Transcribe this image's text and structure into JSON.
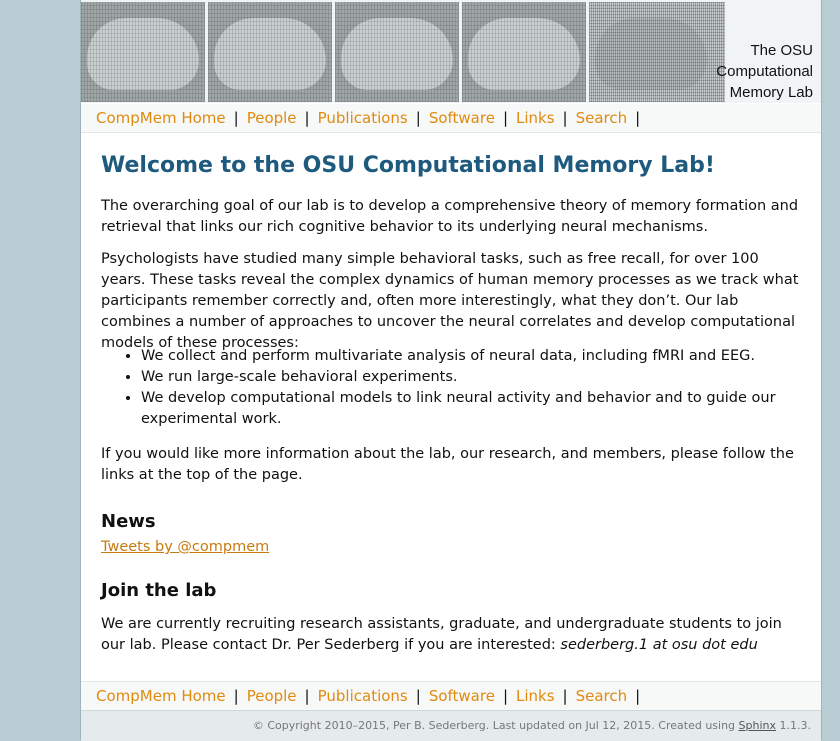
{
  "banner": {
    "title_lines": [
      "The OSU",
      "Computational",
      "Memory Lab"
    ]
  },
  "nav": {
    "items": [
      "CompMem Home",
      "People",
      "Publications",
      "Software",
      "Links",
      "Search"
    ]
  },
  "main": {
    "heading": "Welcome to the OSU Computational Memory Lab!",
    "intro": "The overarching goal of our lab is to develop a comprehensive theory of memory formation and retrieval that links our rich cognitive behavior to its underlying neural mechanisms.",
    "paragraph2": "Psychologists have studied many simple behavioral tasks, such as free recall, for over 100 years. These tasks reveal the complex dynamics of human memory processes as we track what participants remember correctly and, often more interestingly, what they don’t. Our lab combines a number of approaches to uncover the neural correlates and develop computational models of these processes:",
    "bullets": [
      "We collect and perform multivariate analysis of neural data, including fMRI and EEG.",
      "We run large-scale behavioral experiments.",
      "We develop computational models to link neural activity and behavior and to guide our experimental work."
    ],
    "paragraph3": "If you would like more information about the lab, our research, and members, please follow the links at the top of the page.",
    "news_heading": "News",
    "tweets_link": "Tweets by @compmem",
    "join_heading": "Join the lab",
    "join_text": "We are currently recruiting research assistants, graduate, and undergraduate students to join our lab. Please contact Dr. Per Sederberg if you are interested: ",
    "join_email": "sederberg.1 at osu dot edu"
  },
  "footer": {
    "prefix": "© Copyright 2010–2015, Per B. Sederberg. Last updated on Jul 12, 2015. Created using ",
    "sphinx_link": "Sphinx",
    "suffix": " 1.1.3."
  },
  "colors": {
    "heading": "#1e5a7e",
    "nav_link": "#e08a10",
    "page_bg": "#b7ccd3"
  }
}
